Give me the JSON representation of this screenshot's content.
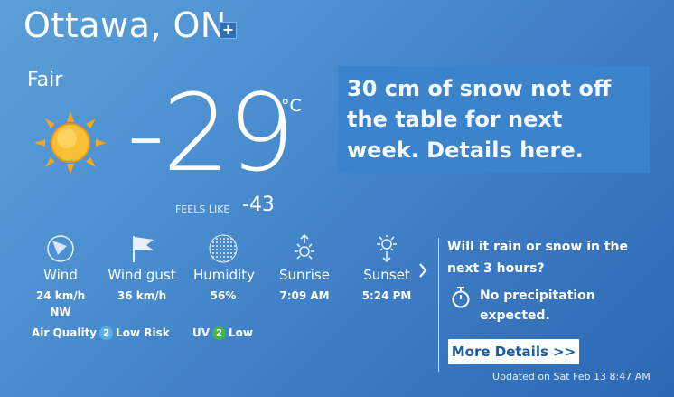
{
  "location": {
    "city": "Ottawa, ON",
    "add_label": "+"
  },
  "current": {
    "condition": "Fair",
    "temperature": "-29",
    "unit": "°C",
    "feels_like_label": "FEELS LIKE",
    "feels_like_value": "-43"
  },
  "promo": {
    "text": "30 cm of snow not off the table for next week. Details here."
  },
  "metrics": [
    {
      "label": "Wind",
      "value": "24 km/h",
      "value2": "NW",
      "icon": "wind-icon"
    },
    {
      "label": "Wind gust",
      "value": "36 km/h",
      "icon": "flag-icon"
    },
    {
      "label": "Humidity",
      "value": "56%",
      "icon": "humidity-icon"
    },
    {
      "label": "Sunrise",
      "value": "7:09 AM",
      "icon": "sunrise-icon"
    },
    {
      "label": "Sunset",
      "value": "5:24 PM",
      "icon": "sunset-icon"
    }
  ],
  "air_quality": {
    "label": "Air Quality",
    "value": "2",
    "risk": "Low Risk",
    "color": "#5ab0e6"
  },
  "uv": {
    "label": "UV",
    "value": "2",
    "risk": "Low",
    "color": "#43b649"
  },
  "precip": {
    "question": "Will it rain or snow in the next 3 hours?",
    "answer": "No precipitation expected.",
    "button": "More Details >>"
  },
  "updated": "Updated on Sat Feb 13 8:47 AM",
  "colors": {
    "accent": "#3a78c1",
    "sun": "#f5a623"
  }
}
